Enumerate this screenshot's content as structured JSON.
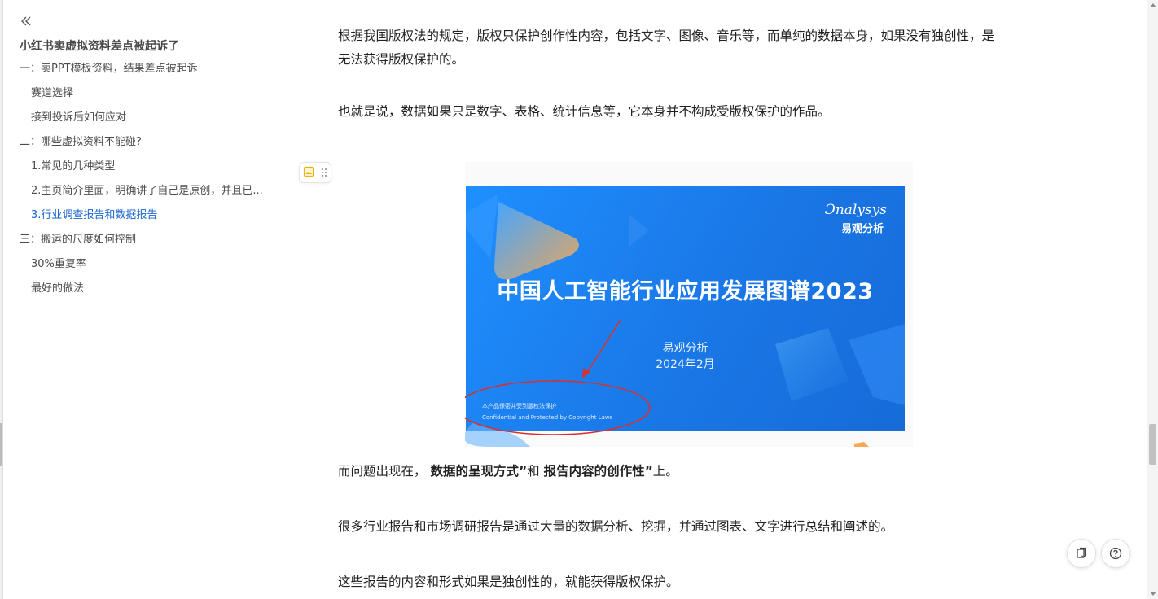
{
  "outline": {
    "title": "小红书卖虚拟资料差点被起诉了",
    "items": [
      {
        "label": "一：卖PPT模板资料，结果差点被起诉",
        "level": 1
      },
      {
        "label": "赛道选择",
        "level": 2
      },
      {
        "label": "接到投诉后如何应对",
        "level": 2
      },
      {
        "label": "二：哪些虚拟资料不能碰?",
        "level": 1
      },
      {
        "label": "1.常见的几种类型",
        "level": 2
      },
      {
        "label": "2.主页简介里面，明确讲了自己是原创，并且已...",
        "level": 2
      },
      {
        "label": "3.行业调查报告和数据报告",
        "level": 2,
        "active": true
      },
      {
        "label": "三：搬运的尺度如何控制",
        "level": 1
      },
      {
        "label": "30%重复率",
        "level": 2
      },
      {
        "label": "最好的做法",
        "level": 2
      }
    ]
  },
  "article": {
    "para1": "根据我国版权法的规定，版权只保护创作性内容，包括文字、图像、音乐等，而单纯的数据本身，如果没有独创性，是无法获得版权保护的。",
    "para2": "也就是说，数据如果只是数字、表格、统计信息等，它本身并不构成受版权保护的作品。",
    "para3_prefix": "而问题出现在，",
    "para3_bold1": "数据的呈现方式”",
    "para3_mid": "和 ",
    "para3_bold2": "报告内容的创作性”",
    "para3_suffix": "上。",
    "para4": "很多行业报告和市场调研报告是通过大量的数据分析、挖掘，并通过图表、文字进行总结和阐述的。",
    "para5": "这些报告的内容和形式如果是独创性的，就能获得版权保护。"
  },
  "figure": {
    "brand_en": "Ɔnalysys",
    "brand_cn": "易观分析",
    "title": "中国人工智能行业应用发展图谱2023",
    "org": "易观分析",
    "date": "2024年2月",
    "confidential_cn": "本产品保密并受到版权法保护",
    "confidential_en": "Confidential and Protected by Copyright Laws"
  },
  "colors": {
    "accent": "#1a66d0",
    "slide_blue": "#1a77e6",
    "annotation_red": "#d9302c"
  },
  "icons": {
    "collapse": "double-chevron-left-icon",
    "image_tool": "image-icon",
    "drag": "drag-handle-icon",
    "copy": "copy-doc-icon",
    "help": "help-circle-icon"
  }
}
